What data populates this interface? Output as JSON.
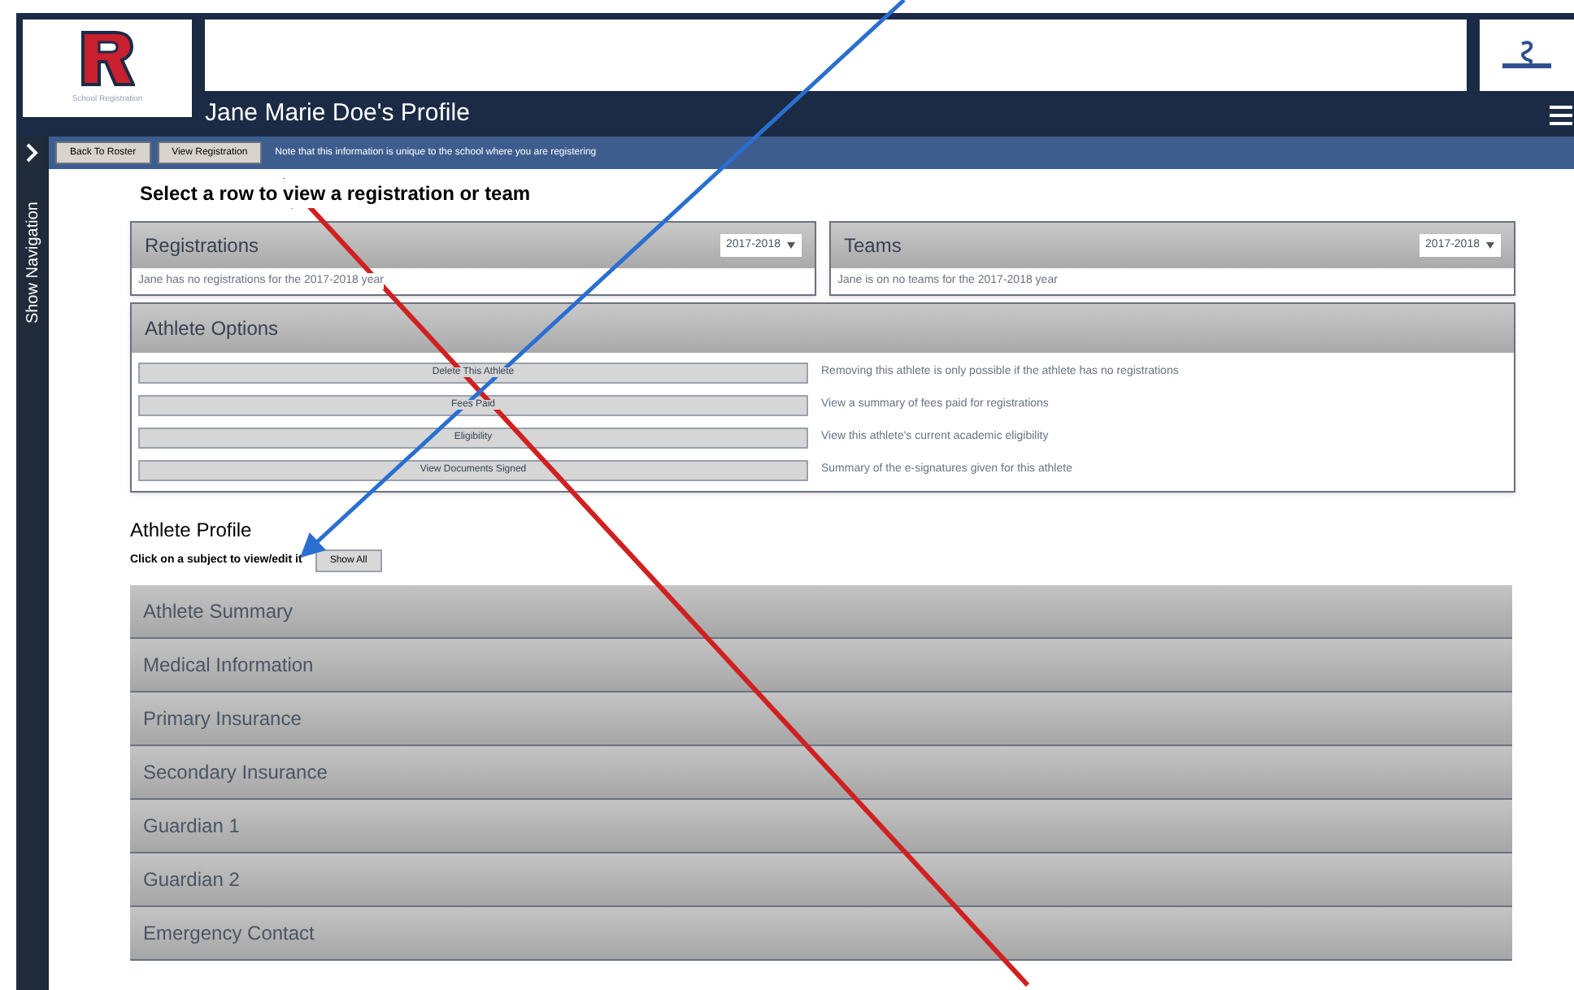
{
  "header": {
    "logo_caption": "School Registration",
    "title": "Jane Marie Doe's Profile"
  },
  "sidebar": {
    "label": "Show Navigation"
  },
  "toolbar": {
    "buttons": [
      "Back To Roster",
      "View Registration"
    ],
    "note": "Note that this information is unique to the school where you are registering"
  },
  "instruction": "Select a row to view a registration or team",
  "panels": [
    {
      "title": "Registrations",
      "year": "2017-2018",
      "message": "Jane has no registrations for the 2017-2018 year"
    },
    {
      "title": "Teams",
      "year": "2017-2018",
      "message": "Jane is on no teams for the 2017-2018 year"
    }
  ],
  "athlete_options": {
    "title": "Athlete Options",
    "rows": [
      {
        "button": "Delete This Athlete",
        "description": "Removing this athlete is only possible if the athlete has no registrations"
      },
      {
        "button": "Fees Paid",
        "description": "View a summary of fees paid for registrations"
      },
      {
        "button": "Eligibility",
        "description": "View this athlete's current academic eligibility"
      },
      {
        "button": "View Documents Signed",
        "description": "Summary of the e-signatures given for this athlete"
      }
    ]
  },
  "athlete_profile": {
    "title": "Athlete Profile",
    "hint": "Click on a subject to view/edit it",
    "show_all": "Show All",
    "sections": [
      "Athlete Summary",
      "Medical Information",
      "Primary Insurance",
      "Secondary Insurance",
      "Guardian 1",
      "Guardian 2",
      "Emergency Contact"
    ]
  }
}
